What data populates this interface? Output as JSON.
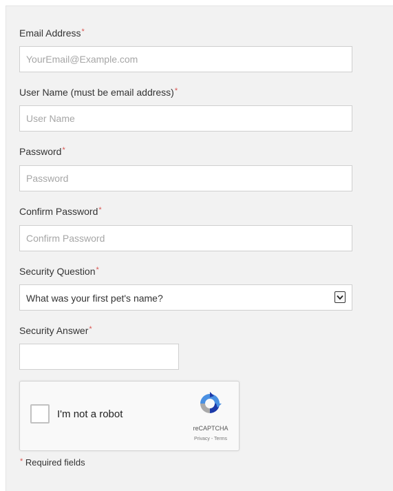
{
  "form": {
    "email": {
      "label": "Email Address",
      "placeholder": "YourEmail@Example.com",
      "value": ""
    },
    "username": {
      "label": "User Name (must be email address)",
      "placeholder": "User Name",
      "value": ""
    },
    "password": {
      "label": "Password",
      "placeholder": "Password",
      "value": ""
    },
    "confirm_password": {
      "label": "Confirm Password",
      "placeholder": "Confirm Password",
      "value": ""
    },
    "security_question": {
      "label": "Security Question",
      "selected": "What was your first pet's name?"
    },
    "security_answer": {
      "label": "Security Answer",
      "value": ""
    },
    "required_marker": "*"
  },
  "captcha": {
    "text": "I'm not a robot",
    "brand": "reCAPTCHA",
    "links": "Privacy - Terms",
    "checked": false
  },
  "footer": {
    "marker": "*",
    "text": " Required fields"
  },
  "colors": {
    "panel_bg": "#f2f2f2",
    "required": "#d9534f",
    "input_border": "#cfcfcf",
    "placeholder": "#a6a6a6"
  },
  "icons": {
    "select_arrow": "chevron-down-icon",
    "captcha_logo": "recaptcha-logo-icon"
  }
}
